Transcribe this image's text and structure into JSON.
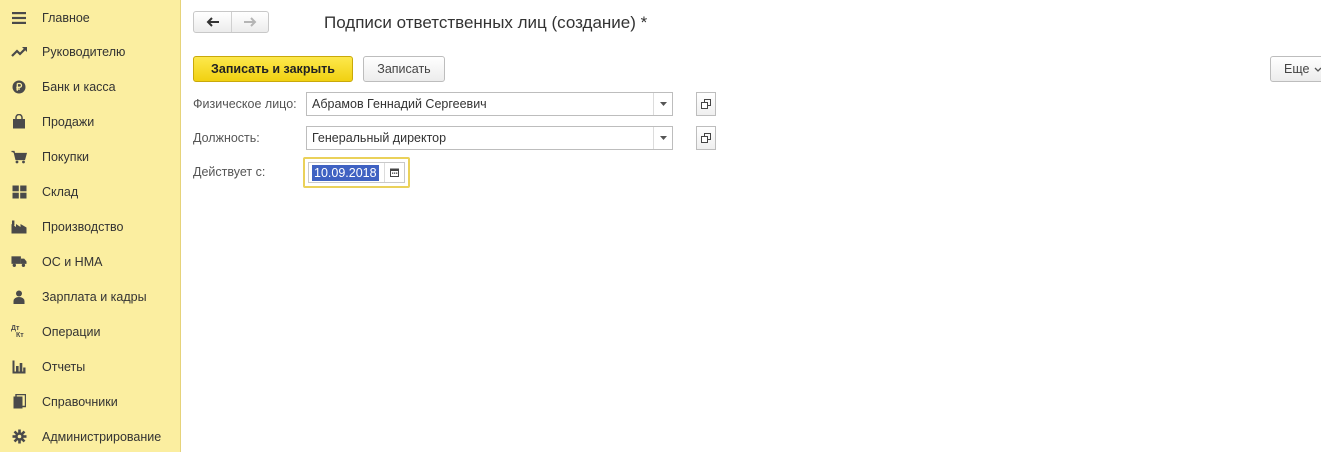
{
  "sidebar": {
    "items": [
      {
        "label": "Главное",
        "icon": "menu-icon"
      },
      {
        "label": "Руководителю",
        "icon": "trend-icon"
      },
      {
        "label": "Банк и касса",
        "icon": "ruble-icon"
      },
      {
        "label": "Продажи",
        "icon": "shopping-bag-icon"
      },
      {
        "label": "Покупки",
        "icon": "cart-icon"
      },
      {
        "label": "Склад",
        "icon": "warehouse-icon"
      },
      {
        "label": "Производство",
        "icon": "factory-icon"
      },
      {
        "label": "ОС и НМА",
        "icon": "truck-icon"
      },
      {
        "label": "Зарплата и кадры",
        "icon": "person-icon"
      },
      {
        "label": "Операции",
        "icon": "dt-kt-icon",
        "icon_text_top": "Дт",
        "icon_text_bottom": "Кт"
      },
      {
        "label": "Отчеты",
        "icon": "bar-chart-icon"
      },
      {
        "label": "Справочники",
        "icon": "books-icon"
      },
      {
        "label": "Администрирование",
        "icon": "gear-icon"
      }
    ]
  },
  "header": {
    "title": "Подписи ответственных лиц (создание) *"
  },
  "toolbar": {
    "save_close_label": "Записать и закрыть",
    "save_label": "Записать",
    "more_label": "Еще"
  },
  "form": {
    "person_label": "Физическое лицо:",
    "person_value": "Абрамов Геннадий Сергеевич",
    "position_label": "Должность:",
    "position_value": "Генеральный директор",
    "valid_from_label": "Действует с:",
    "valid_from_value": "10.09.2018"
  },
  "colors": {
    "sidebar_bg": "#fbeea0",
    "primary_button": "#f5d821",
    "selection": "#3f62c2",
    "focus_border": "#ead15a",
    "icon": "#4a4a4a"
  }
}
